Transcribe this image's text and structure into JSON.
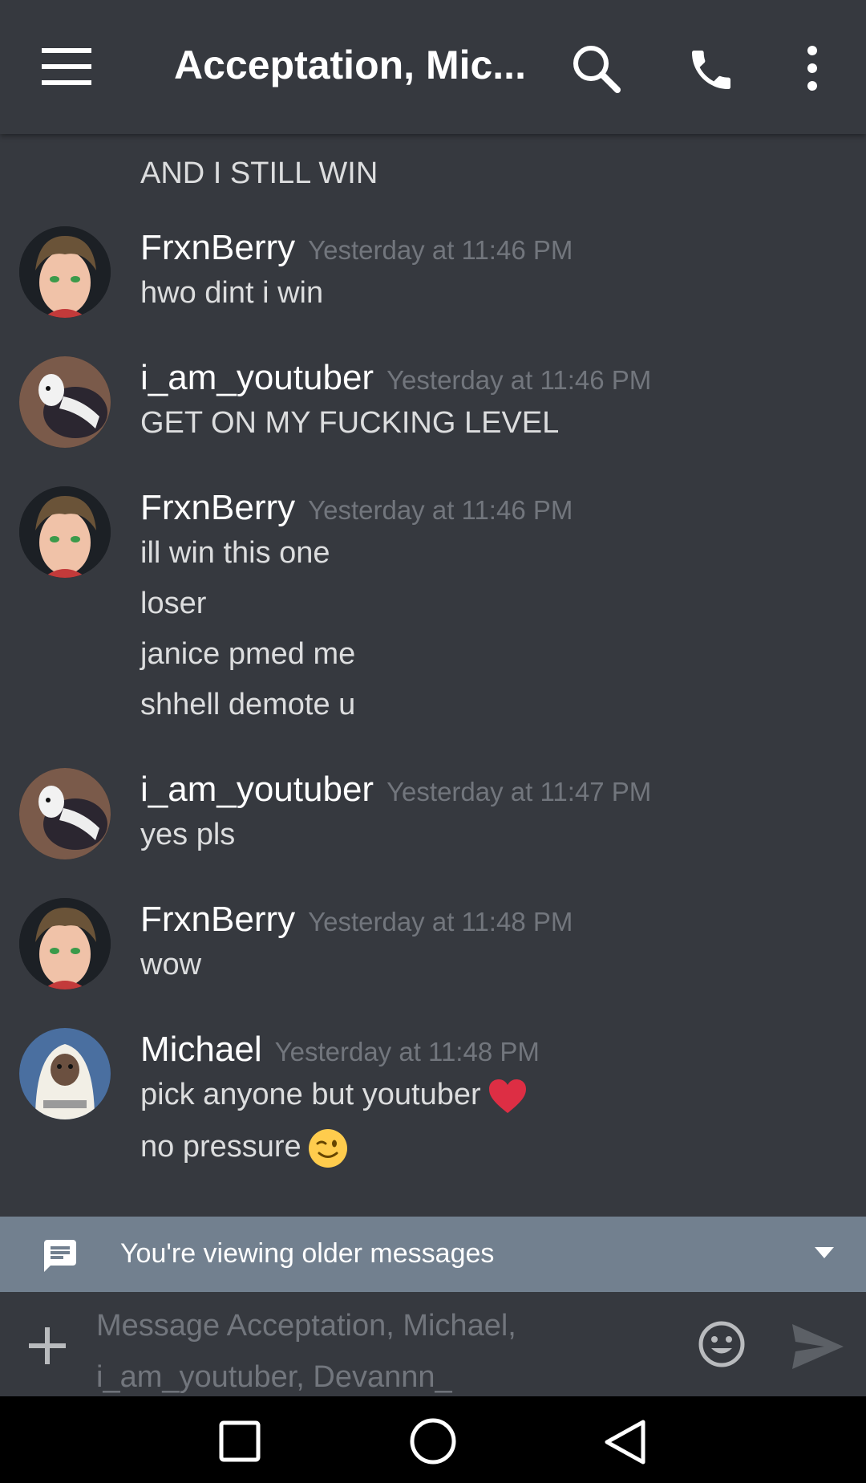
{
  "header": {
    "title": "Acceptation, Mic...",
    "icons": [
      "menu-icon",
      "search-icon",
      "phone-icon",
      "more-vert-icon"
    ]
  },
  "messages": {
    "top_partial_text": "AND I STILL WIN",
    "groups": [
      {
        "username": "FrxnBerry",
        "timestamp": "Yesterday at 11:46 PM",
        "avatar": "anime-boy-avatar",
        "lines": [
          "hwo dint i win"
        ]
      },
      {
        "username": "i_am_youtuber",
        "timestamp": "Yesterday at 11:46 PM",
        "avatar": "goat-avatar",
        "lines": [
          "GET ON MY FUCKING LEVEL"
        ]
      },
      {
        "username": "FrxnBerry",
        "timestamp": "Yesterday at 11:46 PM",
        "avatar": "anime-boy-avatar",
        "lines": [
          "ill win this one",
          "loser",
          "janice pmed me",
          "shhell demote u"
        ]
      },
      {
        "username": "i_am_youtuber",
        "timestamp": "Yesterday at 11:47 PM",
        "avatar": "goat-avatar",
        "lines": [
          "yes pls"
        ]
      },
      {
        "username": "FrxnBerry",
        "timestamp": "Yesterday at 11:48 PM",
        "avatar": "anime-boy-avatar",
        "lines": [
          "wow"
        ]
      },
      {
        "username": "Michael",
        "timestamp": "Yesterday at 11:48 PM",
        "avatar": "et-avatar",
        "lines": [
          "pick anyone but youtuber",
          "no pressure"
        ],
        "line_emojis": [
          "heart-emoji",
          "wink-emoji"
        ]
      }
    ]
  },
  "older_bar": {
    "text": "You're viewing older messages"
  },
  "composer": {
    "placeholder_line1": "Message Acceptation, Michael,",
    "placeholder_line2": "i_am_youtuber, Devannn_"
  },
  "colors": {
    "background": "#36393f",
    "older_bar": "#72808f",
    "timestamp": "#72767d",
    "username": "#ffffff",
    "text": "#dcddde"
  }
}
